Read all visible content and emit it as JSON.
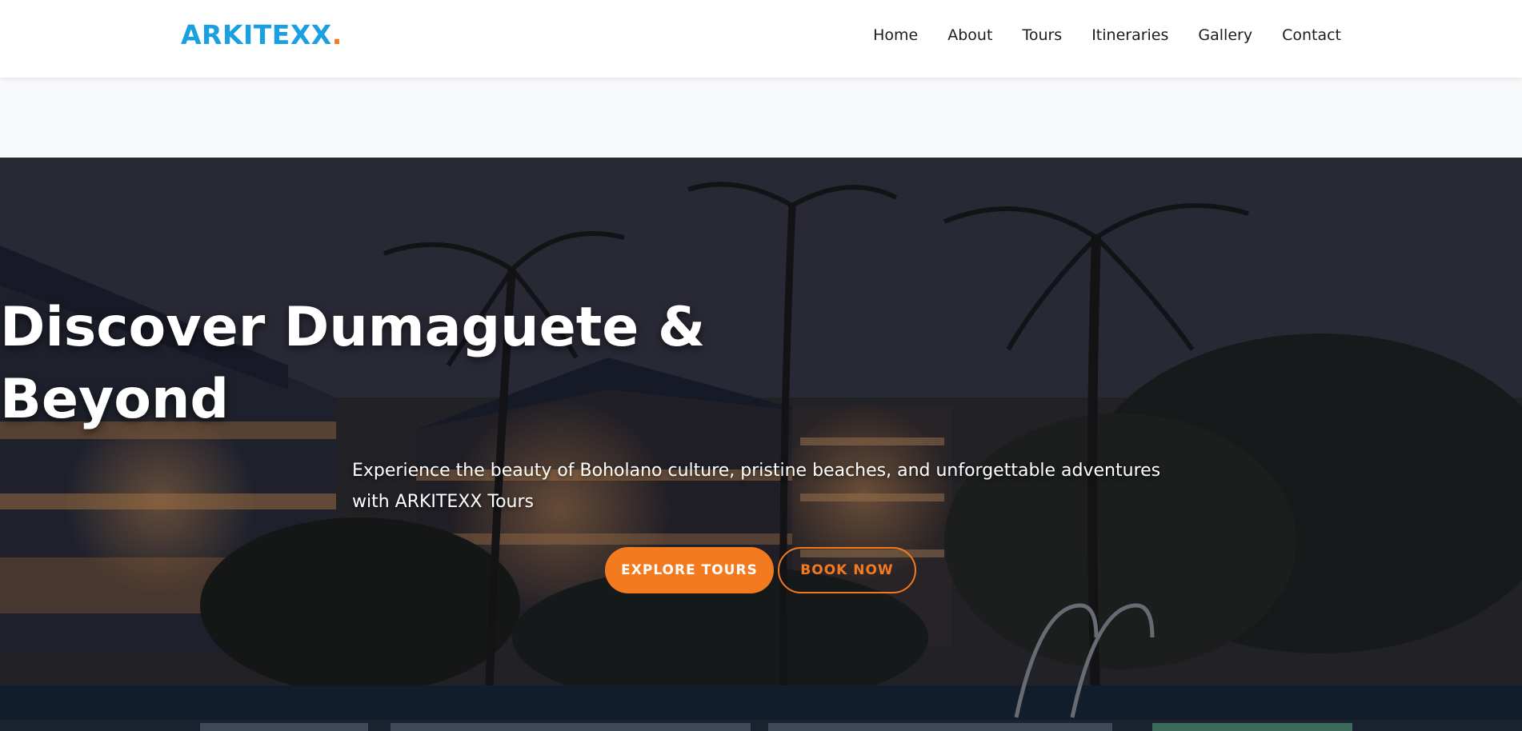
{
  "brand": {
    "name": "ARKITEXX",
    "dot": ".",
    "color": "#1aa0e0",
    "accent": "#f47a20"
  },
  "nav": {
    "items": [
      {
        "label": "Home"
      },
      {
        "label": "About"
      },
      {
        "label": "Tours"
      },
      {
        "label": "Itineraries"
      },
      {
        "label": "Gallery"
      },
      {
        "label": "Contact"
      }
    ]
  },
  "hero": {
    "title_line1": "Discover Dumaguete &",
    "title_line2": "Beyond",
    "subtitle": "Experience the beauty of Boholano culture, pristine beaches, and unforgettable adventures with ARKITEXX Tours",
    "primary_button": "EXPLORE TOURS",
    "secondary_button": "BOOK NOW",
    "background_image": "resort-at-night-with-palm-trees"
  }
}
